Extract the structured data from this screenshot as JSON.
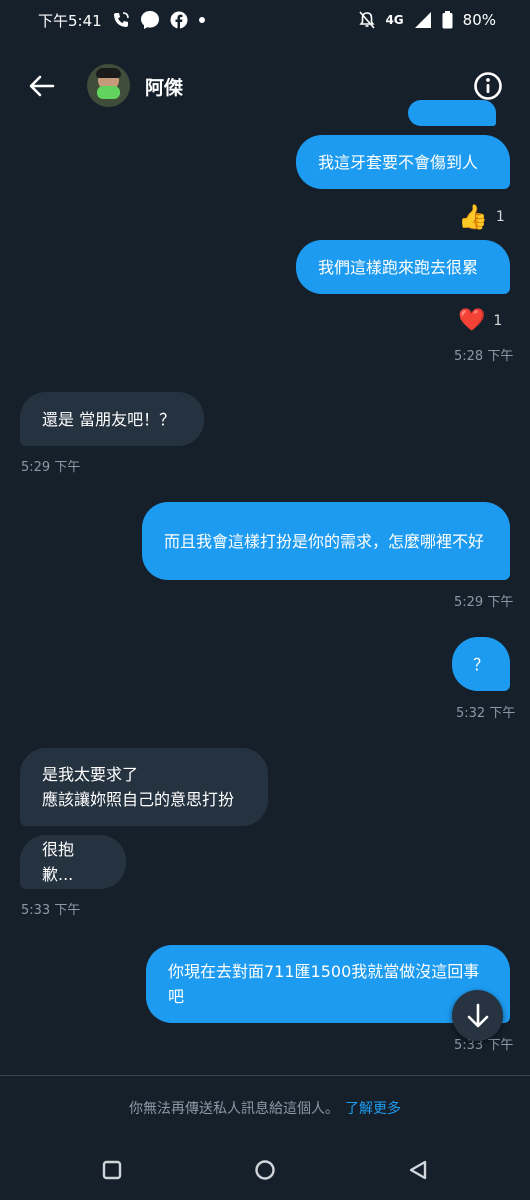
{
  "status_bar": {
    "time": "下午5:41",
    "network": "4G",
    "battery": "80%"
  },
  "header": {
    "contact_name": "阿傑"
  },
  "messages": [
    {
      "text": "我這牙套要不會傷到人"
    },
    {
      "reaction_emoji": "👍",
      "reaction_count": "1"
    },
    {
      "text": "我們這樣跑來跑去很累"
    },
    {
      "reaction_emoji": "❤️",
      "reaction_count": "1",
      "time": "5:28 下午"
    },
    {
      "text": "還是 當朋友吧！？",
      "time": "5:29 下午"
    },
    {
      "text": "而且我會這樣打扮是你的需求，怎麼哪裡不好",
      "time": "5:29 下午"
    },
    {
      "text": "？",
      "time": "5:32 下午"
    },
    {
      "line1": "是我太要求了",
      "line2": "應該讓妳照自己的意思打扮"
    },
    {
      "text": "很抱歉...",
      "time": "5:33 下午"
    },
    {
      "text": "你現在去對面711匯1500我就當做沒這回事吧",
      "time": "5:33 下午"
    }
  ],
  "footer": {
    "notice": "你無法再傳送私人訊息給這個人。",
    "learn_more": "了解更多"
  },
  "colors": {
    "background": "#15202b",
    "outgoing_bubble": "#1d9bf0",
    "incoming_bubble": "#253341",
    "timestamp": "#8b98a5"
  },
  "icons": [
    "back-arrow-icon",
    "info-icon",
    "scroll-down-icon",
    "nav-recents-icon",
    "nav-home-icon",
    "nav-back-icon"
  ]
}
